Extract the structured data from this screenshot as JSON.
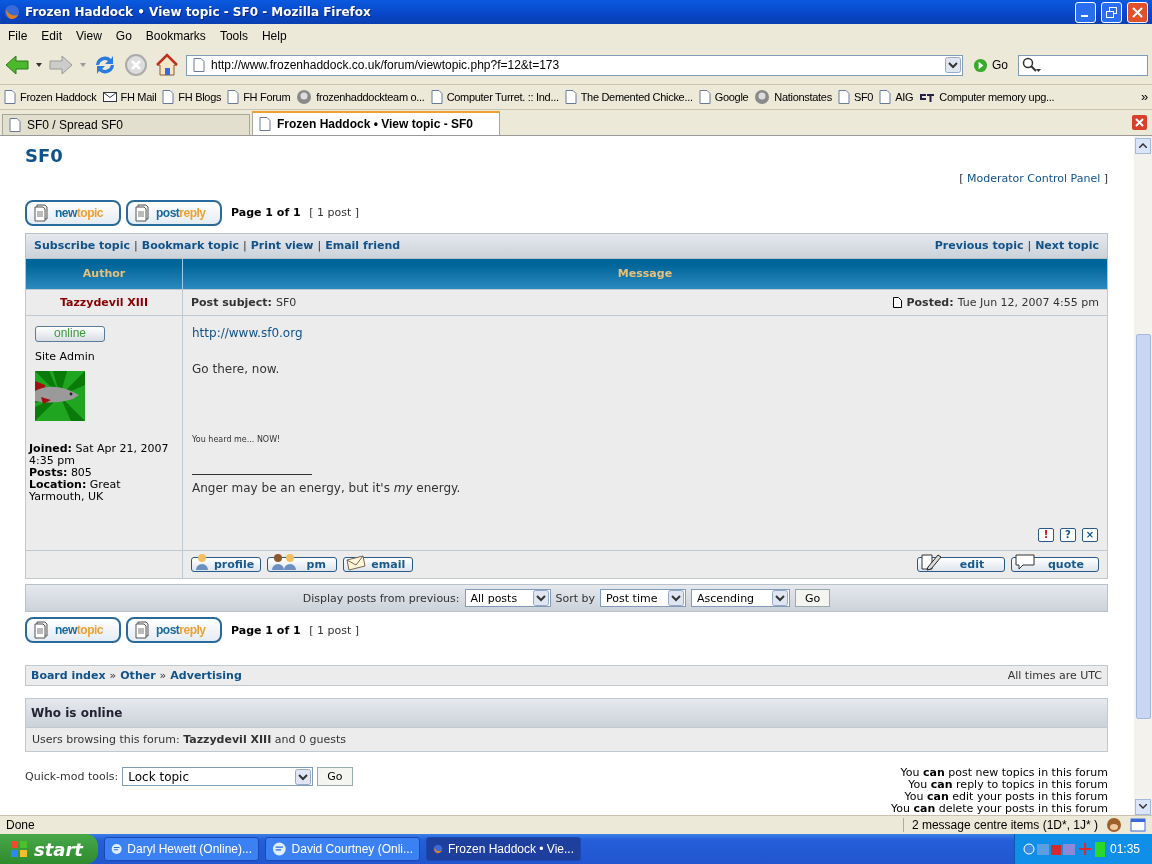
{
  "window": {
    "title": "Frozen Haddock • View topic - SF0 - Mozilla Firefox"
  },
  "menu": [
    "File",
    "Edit",
    "View",
    "Go",
    "Bookmarks",
    "Tools",
    "Help"
  ],
  "toolbar": {
    "address": "http://www.frozenhaddock.co.uk/forum/viewtopic.php?f=12&t=173",
    "go": "Go"
  },
  "bookmarks": [
    {
      "label": "Frozen Haddock",
      "kind": "page"
    },
    {
      "label": "FH Mail",
      "kind": "mail"
    },
    {
      "label": "FH Blogs",
      "kind": "page"
    },
    {
      "label": "FH Forum",
      "kind": "page"
    },
    {
      "label": "frozenhaddockteam o...",
      "kind": "avatar"
    },
    {
      "label": "Computer Turret. :: Ind...",
      "kind": "page"
    },
    {
      "label": "The Demented Chicke...",
      "kind": "page"
    },
    {
      "label": "Google",
      "kind": "page"
    },
    {
      "label": "Nationstates",
      "kind": "avatar"
    },
    {
      "label": "SF0",
      "kind": "page"
    },
    {
      "label": "AIG",
      "kind": "page"
    },
    {
      "label": "Computer memory upg...",
      "kind": "logo"
    }
  ],
  "bookmarks_more": "»",
  "tabs": [
    {
      "label": "SF0 / Spread SF0",
      "selected": false
    },
    {
      "label": "Frozen Haddock • View topic - SF0",
      "selected": true
    }
  ],
  "page": {
    "title": "SF0",
    "mcp": {
      "open": "[",
      "label": "Moderator Control Panel",
      "close": "]"
    },
    "button_rows": [
      {
        "buttons": [
          {
            "first": "new",
            "second": "topic"
          },
          {
            "first": "post",
            "second": "reply"
          }
        ],
        "page": "Page 1 of 1",
        "count": "[ 1 post ]"
      },
      {
        "buttons": [
          {
            "first": "new",
            "second": "topic"
          },
          {
            "first": "post",
            "second": "reply"
          }
        ],
        "page": "Page 1 of 1",
        "count": "[ 1 post ]"
      }
    ],
    "topic_links": [
      "Subscribe topic",
      "Bookmark topic",
      "Print view",
      "Email friend"
    ],
    "nav_links": [
      "Previous topic",
      "Next topic"
    ],
    "link_separator": "|",
    "columns": [
      "Author",
      "Message"
    ],
    "post": {
      "author": "Tazzydevil XIII",
      "subject_label": "Post subject:",
      "subject": "SF0",
      "posted_label": "Posted:",
      "posted": "Tue Jun 12, 2007 4:55 pm",
      "status": "online",
      "rank": "Site Admin",
      "details": [
        {
          "label": "Joined:",
          "value": "Sat Apr 21, 2007 4:35 pm"
        },
        {
          "label": "Posts:",
          "value": "805"
        },
        {
          "label": "Location:",
          "value": "Great Yarmouth, UK"
        }
      ],
      "link": "http://www.sf0.org",
      "text": "Go there, now.",
      "small_text": "You heard me... NOW!",
      "signature": "Anger may be an energy, but it's *my* energy.",
      "icon_buttons": [
        "!",
        "?",
        "×"
      ],
      "user_actions": [
        {
          "label": "profile",
          "kind": "person"
        },
        {
          "label": "pm",
          "kind": "people"
        },
        {
          "label": "email",
          "kind": "mail"
        }
      ],
      "post_actions": [
        {
          "label": "edit",
          "kind": "pen"
        },
        {
          "label": "quote",
          "kind": "bubble"
        }
      ]
    },
    "display": {
      "label": "Display posts from previous:",
      "range": "All posts",
      "sort_label": "Sort by",
      "sort": "Post time",
      "order": "Ascending",
      "go": "Go"
    },
    "breadcrumbs": [
      "Board index",
      "Other",
      "Advertising"
    ],
    "breadcrumb_separator": "»",
    "times": "All times are UTC",
    "who_online": {
      "title": "Who is online",
      "text": "Users browsing this forum: **Tazzydevil XIII** and 0 guests"
    },
    "quickmod": {
      "label": "Quick-mod tools:",
      "value": "Lock topic",
      "go": "Go"
    },
    "permissions": [
      "You **can** post new topics in this forum",
      "You **can** reply to topics in this forum",
      "You **can** edit your posts in this forum",
      "You **can** delete your posts in this forum"
    ]
  },
  "status_bar": {
    "text": "Done",
    "messages": "2 message centre items (1D*, 1J* )"
  },
  "taskbar": {
    "start": "start",
    "items": [
      {
        "label": "Daryl Hewett (Online)...",
        "kind": "chat",
        "selected": false
      },
      {
        "label": "David Courtney (Onli...",
        "kind": "chat",
        "selected": false
      },
      {
        "label": "Frozen Haddock • Vie...",
        "kind": "browser",
        "selected": true
      }
    ],
    "clock": "01:35"
  }
}
